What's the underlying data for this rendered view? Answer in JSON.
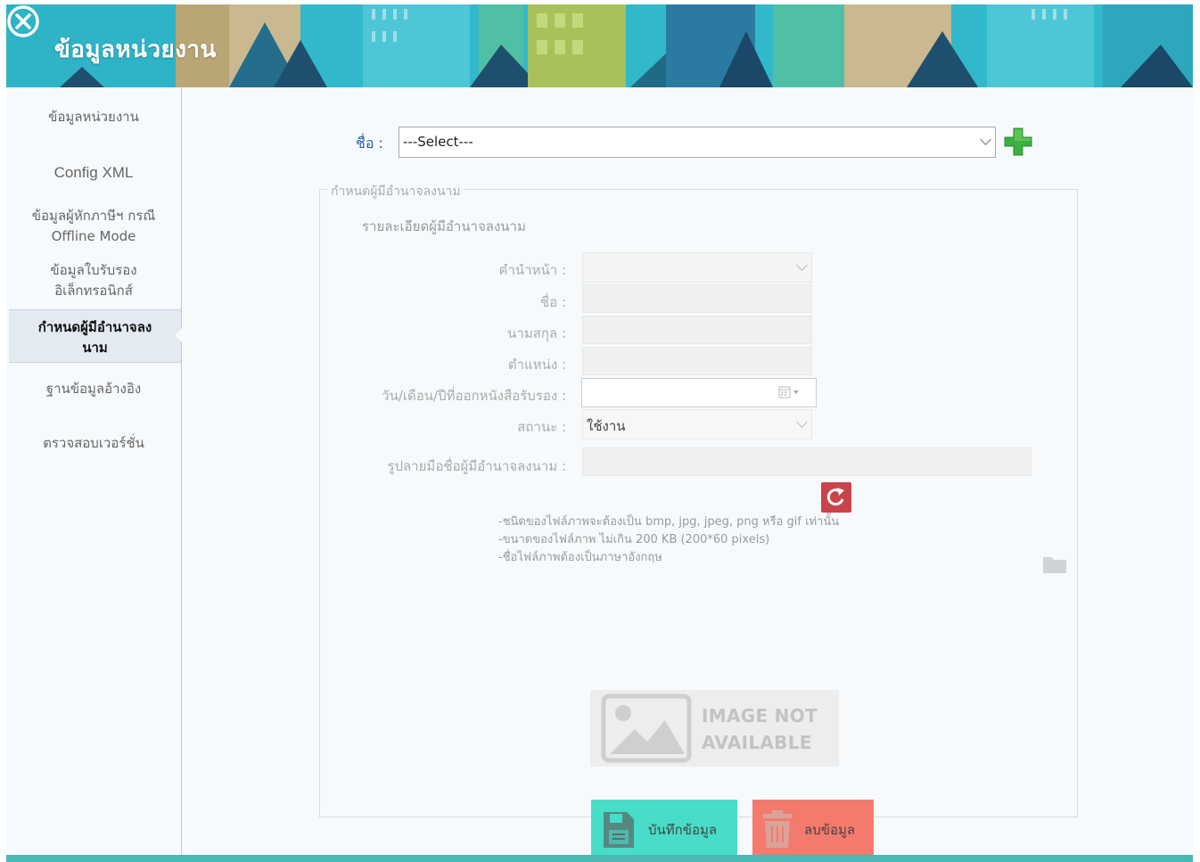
{
  "header": {
    "title": "ข้อมูลหน่วยงาน"
  },
  "sidebar": {
    "items": [
      {
        "label": "ข้อมูลหน่วยงาน"
      },
      {
        "label": "Config XML"
      },
      {
        "label": "ข้อมูลผู้หักภาษีฯ กรณี Offline Mode"
      },
      {
        "label": "ข้อมูลใบรับรองอิเล็กทรอนิกส์"
      },
      {
        "label": "กำหนดผู้มีอำนาจลงนาม"
      },
      {
        "label": "ฐานข้อมูลอ้างอิง"
      },
      {
        "label": "ตรวจสอบเวอร์ชั่น"
      }
    ],
    "active_index": 4
  },
  "main": {
    "name_label": "ชื่อ :",
    "name_select_value": "---Select---",
    "section_legend": "กำหนดผู้มีอำนาจลงนาม",
    "section_subtitle": "รายละเอียดผู้มีอำนาจลงนาม",
    "fields": {
      "prefix_label": "คำนำหน้า :",
      "firstname_label": "ชื่อ :",
      "lastname_label": "นามสกุล :",
      "position_label": "ตำแหน่ง :",
      "date_label": "วัน/เดือน/ปีที่ออกหนังสือรับรอง :",
      "status_label": "สถานะ :",
      "status_value": "ใช้งาน",
      "signature_label": "รูปลายมือชื่อผู้มีอำนาจลงนาม :"
    },
    "notes": [
      "-ชนิดของไฟล์ภาพจะต้องเป็น bmp, jpg, jpeg, png หรือ gif เท่านั้น",
      "-ขนาดของไฟล์ภาพ ไม่เกิน 200 KB (200*60 pixels)",
      "-ชื่อไฟล์ภาพต้องเป็นภาษาอังกฤษ"
    ],
    "image_placeholder": {
      "line1": "IMAGE NOT",
      "line2": "AVAILABLE"
    },
    "save_button": "บันทึกข้อมูล",
    "delete_button": "ลบข้อมูล"
  },
  "colors": {
    "header_bg": "#2fb7c9",
    "save_button": "#48ddc8",
    "delete_button": "#f57a6e",
    "refresh_button": "#c9434d",
    "add_icon": "#3cb043"
  }
}
